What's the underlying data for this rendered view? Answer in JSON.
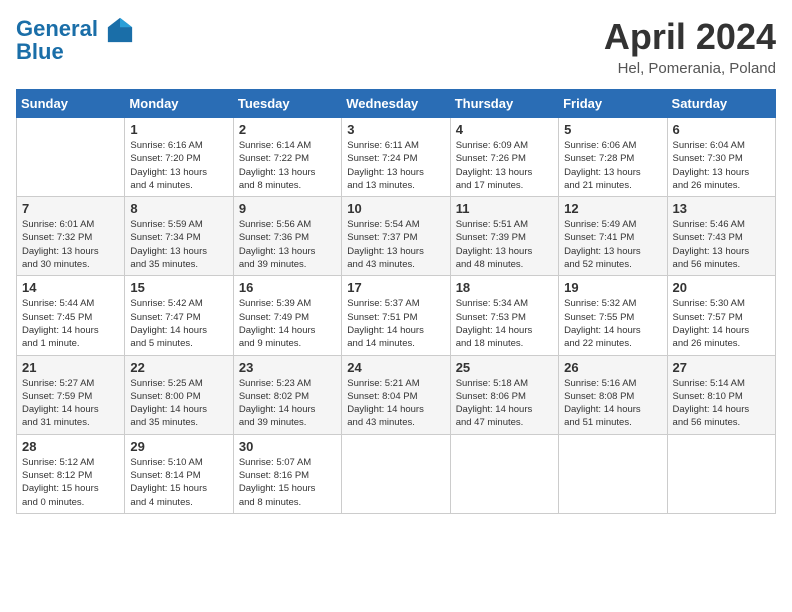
{
  "header": {
    "logo_line1": "General",
    "logo_line2": "Blue",
    "month_year": "April 2024",
    "location": "Hel, Pomerania, Poland"
  },
  "days_of_week": [
    "Sunday",
    "Monday",
    "Tuesday",
    "Wednesday",
    "Thursday",
    "Friday",
    "Saturday"
  ],
  "weeks": [
    [
      {
        "day": "",
        "info": ""
      },
      {
        "day": "1",
        "info": "Sunrise: 6:16 AM\nSunset: 7:20 PM\nDaylight: 13 hours\nand 4 minutes."
      },
      {
        "day": "2",
        "info": "Sunrise: 6:14 AM\nSunset: 7:22 PM\nDaylight: 13 hours\nand 8 minutes."
      },
      {
        "day": "3",
        "info": "Sunrise: 6:11 AM\nSunset: 7:24 PM\nDaylight: 13 hours\nand 13 minutes."
      },
      {
        "day": "4",
        "info": "Sunrise: 6:09 AM\nSunset: 7:26 PM\nDaylight: 13 hours\nand 17 minutes."
      },
      {
        "day": "5",
        "info": "Sunrise: 6:06 AM\nSunset: 7:28 PM\nDaylight: 13 hours\nand 21 minutes."
      },
      {
        "day": "6",
        "info": "Sunrise: 6:04 AM\nSunset: 7:30 PM\nDaylight: 13 hours\nand 26 minutes."
      }
    ],
    [
      {
        "day": "7",
        "info": "Sunrise: 6:01 AM\nSunset: 7:32 PM\nDaylight: 13 hours\nand 30 minutes."
      },
      {
        "day": "8",
        "info": "Sunrise: 5:59 AM\nSunset: 7:34 PM\nDaylight: 13 hours\nand 35 minutes."
      },
      {
        "day": "9",
        "info": "Sunrise: 5:56 AM\nSunset: 7:36 PM\nDaylight: 13 hours\nand 39 minutes."
      },
      {
        "day": "10",
        "info": "Sunrise: 5:54 AM\nSunset: 7:37 PM\nDaylight: 13 hours\nand 43 minutes."
      },
      {
        "day": "11",
        "info": "Sunrise: 5:51 AM\nSunset: 7:39 PM\nDaylight: 13 hours\nand 48 minutes."
      },
      {
        "day": "12",
        "info": "Sunrise: 5:49 AM\nSunset: 7:41 PM\nDaylight: 13 hours\nand 52 minutes."
      },
      {
        "day": "13",
        "info": "Sunrise: 5:46 AM\nSunset: 7:43 PM\nDaylight: 13 hours\nand 56 minutes."
      }
    ],
    [
      {
        "day": "14",
        "info": "Sunrise: 5:44 AM\nSunset: 7:45 PM\nDaylight: 14 hours\nand 1 minute."
      },
      {
        "day": "15",
        "info": "Sunrise: 5:42 AM\nSunset: 7:47 PM\nDaylight: 14 hours\nand 5 minutes."
      },
      {
        "day": "16",
        "info": "Sunrise: 5:39 AM\nSunset: 7:49 PM\nDaylight: 14 hours\nand 9 minutes."
      },
      {
        "day": "17",
        "info": "Sunrise: 5:37 AM\nSunset: 7:51 PM\nDaylight: 14 hours\nand 14 minutes."
      },
      {
        "day": "18",
        "info": "Sunrise: 5:34 AM\nSunset: 7:53 PM\nDaylight: 14 hours\nand 18 minutes."
      },
      {
        "day": "19",
        "info": "Sunrise: 5:32 AM\nSunset: 7:55 PM\nDaylight: 14 hours\nand 22 minutes."
      },
      {
        "day": "20",
        "info": "Sunrise: 5:30 AM\nSunset: 7:57 PM\nDaylight: 14 hours\nand 26 minutes."
      }
    ],
    [
      {
        "day": "21",
        "info": "Sunrise: 5:27 AM\nSunset: 7:59 PM\nDaylight: 14 hours\nand 31 minutes."
      },
      {
        "day": "22",
        "info": "Sunrise: 5:25 AM\nSunset: 8:00 PM\nDaylight: 14 hours\nand 35 minutes."
      },
      {
        "day": "23",
        "info": "Sunrise: 5:23 AM\nSunset: 8:02 PM\nDaylight: 14 hours\nand 39 minutes."
      },
      {
        "day": "24",
        "info": "Sunrise: 5:21 AM\nSunset: 8:04 PM\nDaylight: 14 hours\nand 43 minutes."
      },
      {
        "day": "25",
        "info": "Sunrise: 5:18 AM\nSunset: 8:06 PM\nDaylight: 14 hours\nand 47 minutes."
      },
      {
        "day": "26",
        "info": "Sunrise: 5:16 AM\nSunset: 8:08 PM\nDaylight: 14 hours\nand 51 minutes."
      },
      {
        "day": "27",
        "info": "Sunrise: 5:14 AM\nSunset: 8:10 PM\nDaylight: 14 hours\nand 56 minutes."
      }
    ],
    [
      {
        "day": "28",
        "info": "Sunrise: 5:12 AM\nSunset: 8:12 PM\nDaylight: 15 hours\nand 0 minutes."
      },
      {
        "day": "29",
        "info": "Sunrise: 5:10 AM\nSunset: 8:14 PM\nDaylight: 15 hours\nand 4 minutes."
      },
      {
        "day": "30",
        "info": "Sunrise: 5:07 AM\nSunset: 8:16 PM\nDaylight: 15 hours\nand 8 minutes."
      },
      {
        "day": "",
        "info": ""
      },
      {
        "day": "",
        "info": ""
      },
      {
        "day": "",
        "info": ""
      },
      {
        "day": "",
        "info": ""
      }
    ]
  ]
}
